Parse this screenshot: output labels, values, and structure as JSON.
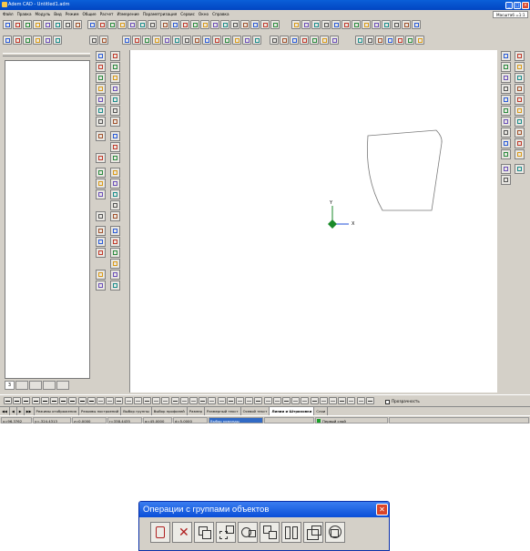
{
  "app": {
    "title": "Adem CAD - Untitled1.adm",
    "menu": [
      "Файл",
      "Правка",
      "Модуль",
      "Вид",
      "Режим",
      "Общие",
      "Расчет",
      "Измерение",
      "Параметризация",
      "Сервис",
      "Окно",
      "Справка"
    ],
    "zoom_label": "Масштаб =1:1"
  },
  "left_panel": {
    "tab_number": "3"
  },
  "canvas": {
    "axis_x_label": "X",
    "axis_y_label": "Y"
  },
  "line_toolbar": {
    "transparency_label": "Прозрачность"
  },
  "tabs": [
    "Режимы отображения",
    "Режимы построений",
    "Выбор группы",
    "Выбор профилей",
    "Размер",
    "Размерный текст",
    "Осевой текст",
    "Линии и Штриховки",
    "Слои"
  ],
  "active_tab": "Линии и Штриховки",
  "status": {
    "x": "x=96.3762",
    "y": "y=-324.4313",
    "z": "z=0.0000",
    "r": "r=338.4435",
    "angle": "α=45.0000",
    "d": "d=5.0000",
    "command": "Выбор команды",
    "layer": "Первый слой"
  },
  "group_window": {
    "title": "Операции с группами объектов",
    "close": "✕"
  },
  "colors": {
    "title_blue": "#0245c2",
    "face": "#d4d0c8",
    "axis_green": "#1a8a2a",
    "axis_blue": "#1f4fd8"
  }
}
